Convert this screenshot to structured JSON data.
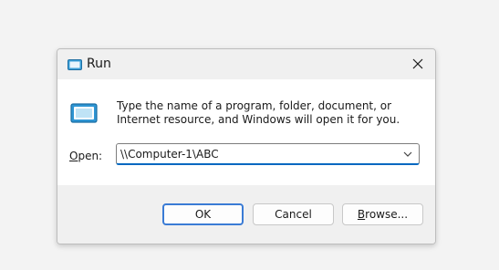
{
  "window": {
    "title": "Run",
    "close_icon": "close-icon",
    "app_icon": "run-icon"
  },
  "content": {
    "description": "Type the name of a program, folder, document, or Internet resource, and Windows will open it for you.",
    "open_label_accel": "O",
    "open_label_rest": "pen:",
    "input_value": "\\\\Computer-1\\ABC",
    "dropdown_icon": "chevron-down-icon"
  },
  "buttons": {
    "ok": "OK",
    "cancel": "Cancel",
    "browse_accel": "B",
    "browse_rest": "rowse..."
  },
  "colors": {
    "accent": "#0067c0",
    "dialog_bg": "#f0f0f0",
    "content_bg": "#ffffff"
  }
}
